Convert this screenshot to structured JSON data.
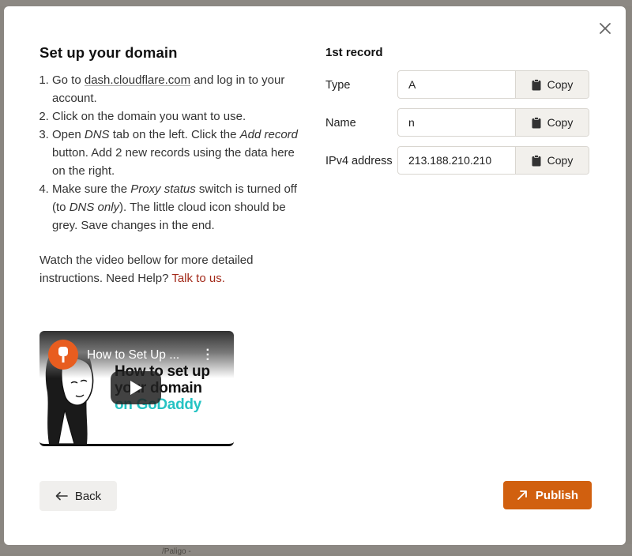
{
  "modal": {
    "close_icon": "close-icon"
  },
  "instructions": {
    "title": "Set up your domain",
    "step1_pre": "Go to ",
    "step1_link": "dash.cloudflare.com",
    "step1_post": " and log in to your account.",
    "step2": "Click on the domain you want to use.",
    "step3_a": "Open ",
    "step3_dns": "DNS",
    "step3_b": " tab on the left. Click the ",
    "step3_add": "Add record",
    "step3_c": " button. Add 2 new records using the data here on the right.",
    "step4_a": "Make sure the ",
    "step4_proxy": "Proxy status",
    "step4_b": " switch is turned off (to ",
    "step4_dns": "DNS only",
    "step4_c": "). The little cloud icon should be grey. Save changes in the end.",
    "help_text": "Watch the video bellow for more detailed instructions. Need Help? ",
    "help_link": "Talk to us."
  },
  "video": {
    "title": "How to Set Up ...",
    "thumb_line1": "How to set up",
    "thumb_line2": "your domain",
    "thumb_line3": "on GoDaddy"
  },
  "record": {
    "heading": "1st record",
    "rows": [
      {
        "label": "Type",
        "value": "A",
        "copy": "Copy"
      },
      {
        "label": "Name",
        "value": "n",
        "copy": "Copy"
      },
      {
        "label": "IPv4 address",
        "value": "213.188.210.210",
        "copy": "Copy"
      }
    ]
  },
  "footer": {
    "back_label": "Back",
    "publish_label": "Publish"
  },
  "background": {
    "partial_text": "/Paligo -"
  },
  "colors": {
    "accent": "#d1600f",
    "link": "#a32a1a"
  }
}
